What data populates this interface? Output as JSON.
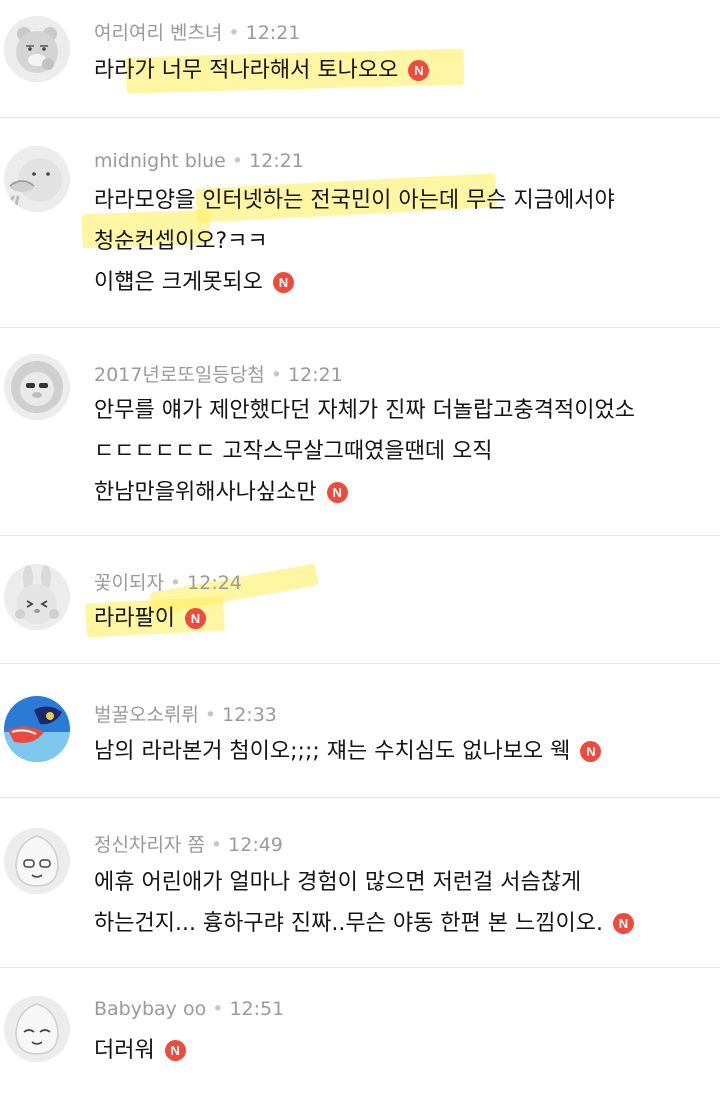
{
  "badge_label": "N",
  "comments": [
    {
      "username": "여리여리 벤츠녀",
      "separator": "•",
      "time": "12:21",
      "lines": [
        "라라가 너무 적나라해서 토나오오"
      ]
    },
    {
      "username": "midnight blue",
      "separator": "•",
      "time": "12:21",
      "lines": [
        "라라모양을 인터넷하는 전국민이 아는데 무슨 지금에서야",
        "청순컨셉이오?ㅋㅋ",
        "이햽은 크게못되오"
      ]
    },
    {
      "username": "2017년로또일등당첨",
      "separator": "•",
      "time": "12:21",
      "lines": [
        "안무를 얘가 제안했다던 자체가 진짜 더놀랍고충격적이었소",
        "ㄷㄷㄷㄷㄷㄷ 고작스무살그때였을땐데 오직",
        "한남만을위해사나싶소만"
      ]
    },
    {
      "username": "꽃이되자",
      "separator": "•",
      "time": "12:24",
      "lines": [
        "라라팔이"
      ]
    },
    {
      "username": "벌꿀오소뤼뤼",
      "separator": "•",
      "time": "12:33",
      "lines": [
        "남의 라라본거 첨이오;;;; 쟤는 수치심도 없나보오 웩"
      ]
    },
    {
      "username": "정신차리자 쫌",
      "separator": "•",
      "time": "12:49",
      "lines": [
        "에휴 어린애가 얼마나 경험이 많으면 저런걸 서슴찮게",
        "하는건지... 흉하구랴 진짜..무슨 야동 한편 본 느낌이오."
      ]
    },
    {
      "username": "Babybay oo",
      "separator": "•",
      "time": "12:51",
      "lines": [
        "더러워"
      ]
    }
  ]
}
